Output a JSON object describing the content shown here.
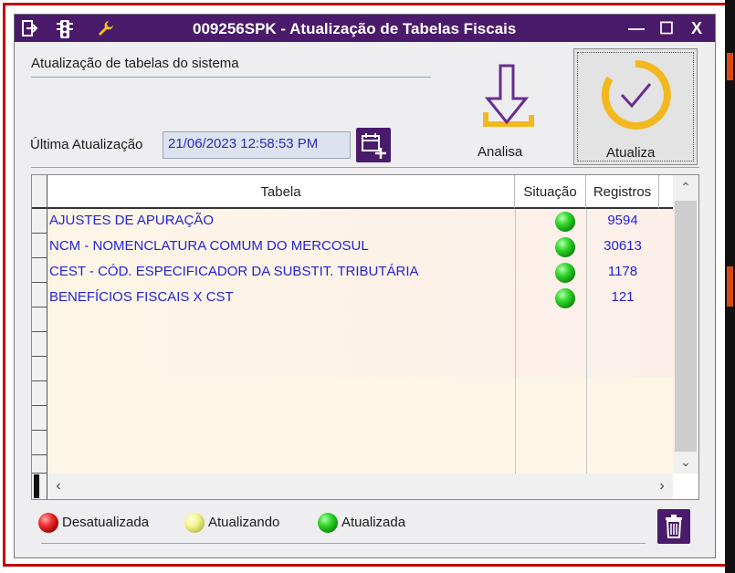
{
  "window": {
    "title": "009256SPK - Atualização de Tabelas Fiscais",
    "controls": {
      "minimize": "—",
      "maximize": "☐",
      "close": "X"
    }
  },
  "header": {
    "section_title": "Atualização de tabelas do sistema",
    "last_update_label": "Última Atualização",
    "last_update_value": "21/06/2023 12:58:53 PM"
  },
  "actions": {
    "analisa_label": "Analisa",
    "atualiza_label": "Atualiza"
  },
  "grid": {
    "columns": [
      "Tabela",
      "Situação",
      "Registros"
    ],
    "rows": [
      {
        "tabela": "AJUSTES DE APURAÇÃO",
        "situacao": "Atualizada",
        "registros": "9594"
      },
      {
        "tabela": "NCM - NOMENCLATURA COMUM DO MERCOSUL",
        "situacao": "Atualizada",
        "registros": "30613"
      },
      {
        "tabela": "CEST - CÓD. ESPECIFICADOR DA SUBSTIT. TRIBUTÁRIA",
        "situacao": "Atualizada",
        "registros": "1178"
      },
      {
        "tabela": "BENEFÍCIOS FISCAIS X CST",
        "situacao": "Atualizada",
        "registros": "121"
      }
    ]
  },
  "legend": {
    "desatualizada": "Desatualizada",
    "atualizando": "Atualizando",
    "atualizada": "Atualizada"
  },
  "colors": {
    "accent_purple": "#4a1a6b",
    "frame_red": "#c40000",
    "link_blue": "#2323d6",
    "status_green": "#32d82c",
    "status_red": "#f03030",
    "status_yellow": "#f2f28a",
    "icon_gold": "#f3b81f"
  }
}
